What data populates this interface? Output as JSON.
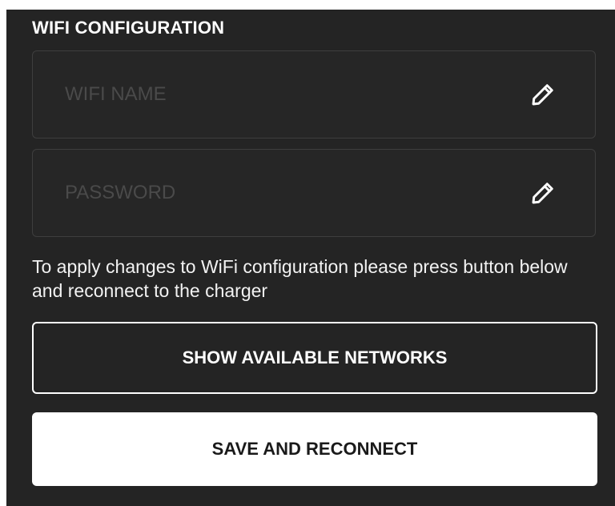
{
  "wifi_section": {
    "title": "WIFI CONFIGURATION",
    "name_field": {
      "placeholder": "WIFI NAME",
      "value": "",
      "edit_icon": "pencil-icon"
    },
    "password_field": {
      "placeholder": "PASSWORD",
      "value": "",
      "edit_icon": "pencil-icon"
    },
    "help_text": "To apply changes to WiFi configuration please press button below and reconnect to the charger",
    "show_networks_label": "SHOW AVAILABLE NETWORKS",
    "save_label": "SAVE AND RECONNECT"
  },
  "colors": {
    "panel_background": "#242424",
    "field_border": "#3e3e3e",
    "text_primary": "#ffffff",
    "placeholder": "#4a4a4a",
    "primary_button_background": "#ffffff",
    "primary_button_text": "#1a1a1a"
  }
}
